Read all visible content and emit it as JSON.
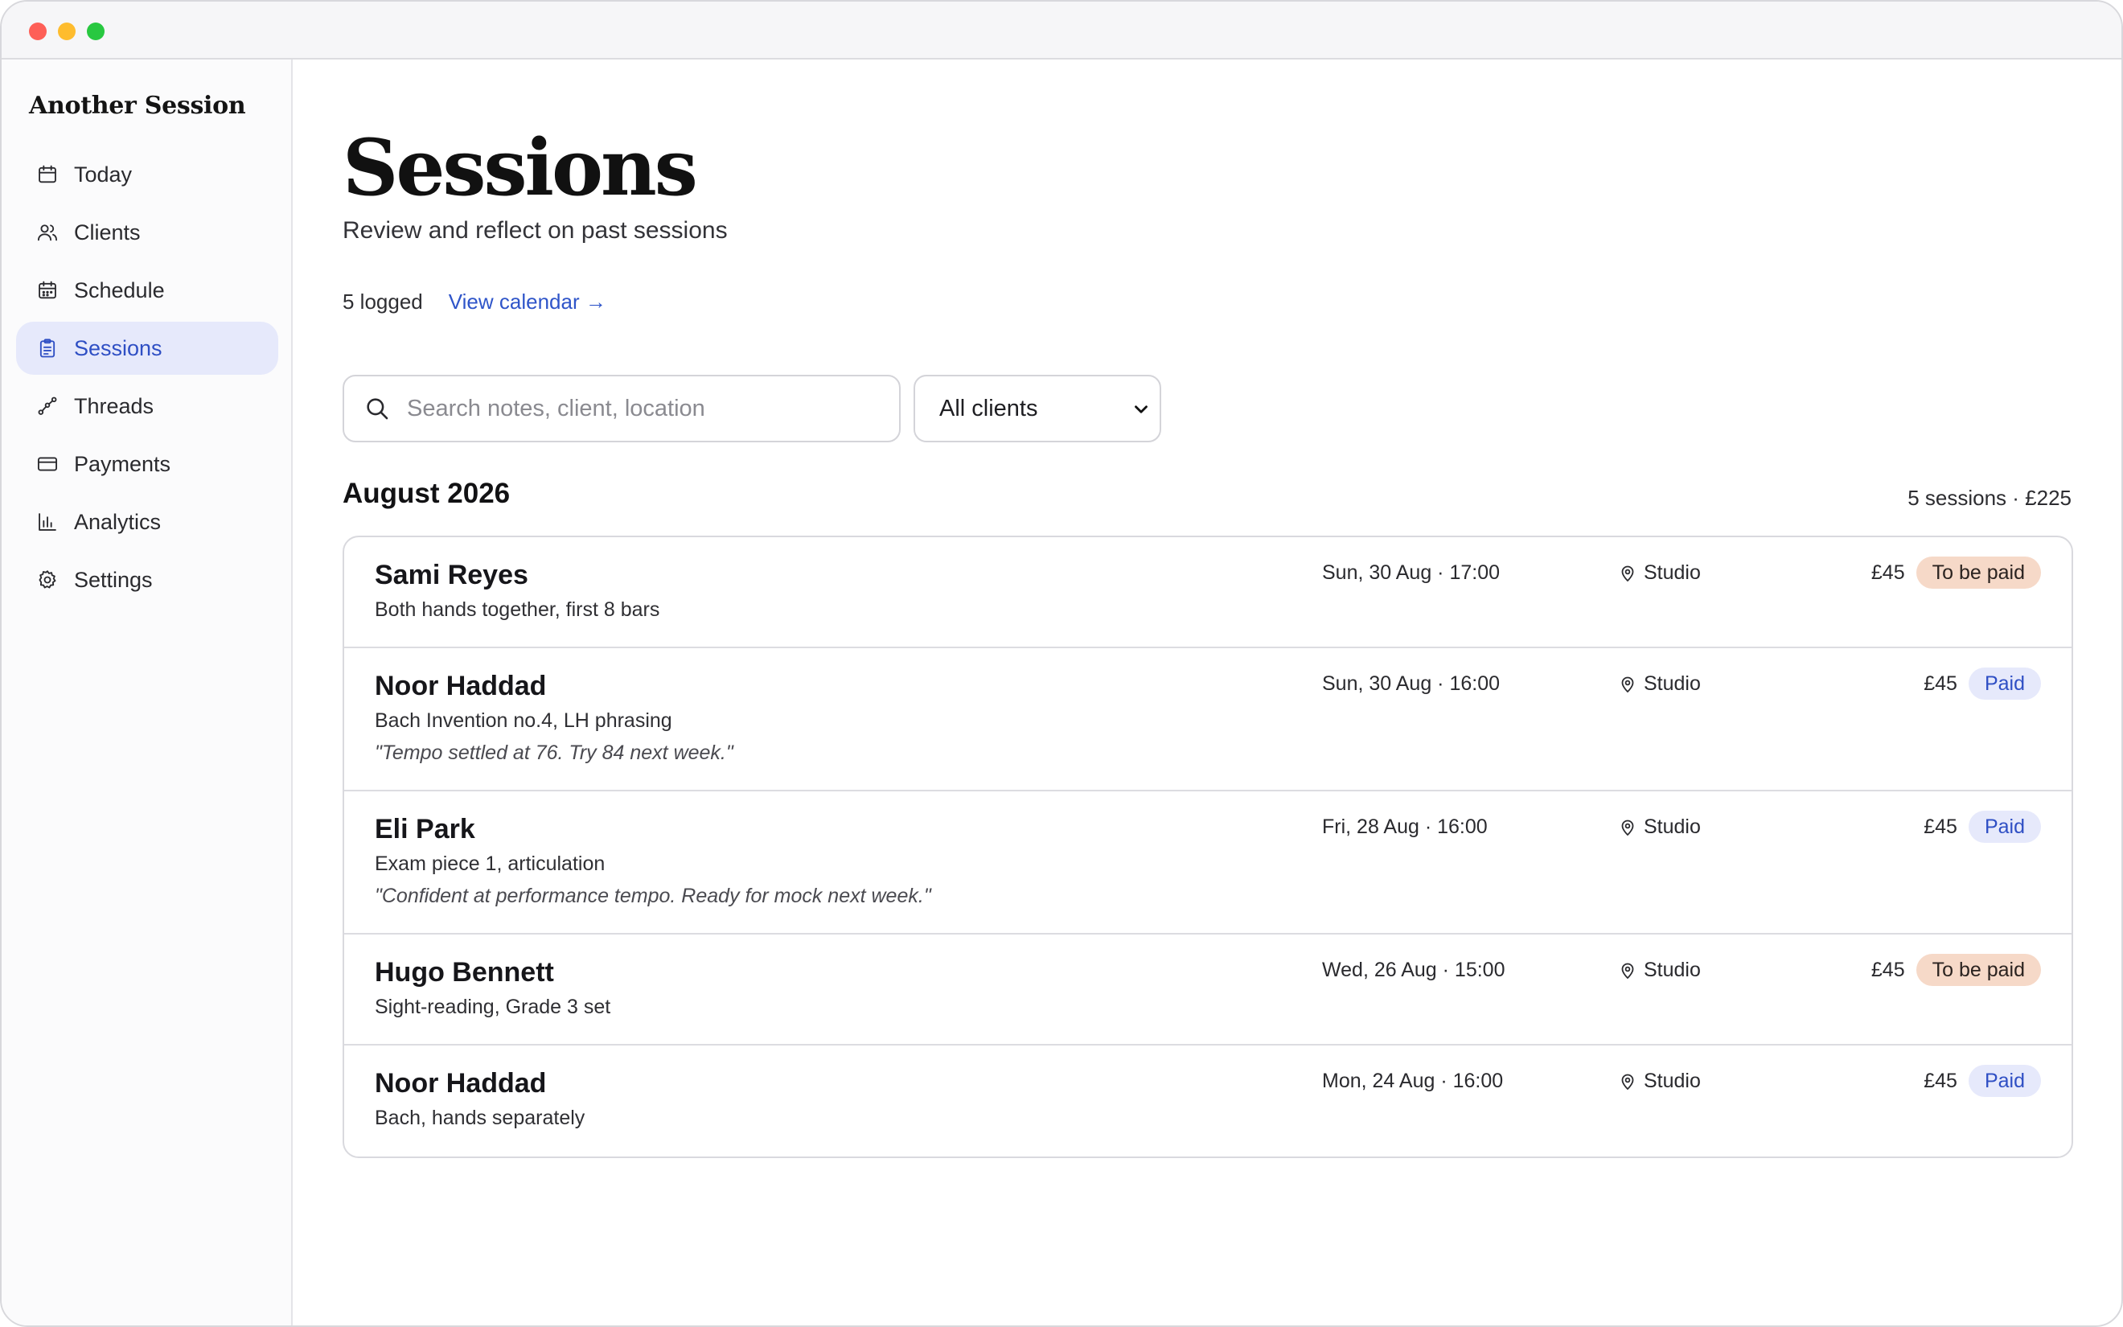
{
  "app": {
    "brand": "Another Session"
  },
  "sidebar": {
    "items": [
      {
        "label": "Today",
        "icon": "calendar-icon",
        "active": false
      },
      {
        "label": "Clients",
        "icon": "users-icon",
        "active": false
      },
      {
        "label": "Schedule",
        "icon": "calendar-grid-icon",
        "active": false
      },
      {
        "label": "Sessions",
        "icon": "clipboard-icon",
        "active": true
      },
      {
        "label": "Threads",
        "icon": "threads-icon",
        "active": false
      },
      {
        "label": "Payments",
        "icon": "credit-card-icon",
        "active": false
      },
      {
        "label": "Analytics",
        "icon": "bar-chart-icon",
        "active": false
      },
      {
        "label": "Settings",
        "icon": "gear-icon",
        "active": false
      }
    ]
  },
  "header": {
    "title": "Sessions",
    "subtitle": "Review and reflect on past sessions",
    "count": "5 logged",
    "calendar_link": "View calendar →"
  },
  "filters": {
    "search_placeholder": "Search notes, client, location",
    "search_value": "",
    "client_select": "All clients"
  },
  "group": {
    "month": "August 2026",
    "summary": "5 sessions · £225"
  },
  "sessions": [
    {
      "name": "Sami Reyes",
      "desc": "Both hands together, first 8 bars",
      "quote": "",
      "date": "Sun, 30 Aug · 17:00",
      "location": "Studio",
      "price": "£45",
      "status": "To be paid",
      "paid": false
    },
    {
      "name": "Noor Haddad",
      "desc": "Bach Invention no.4, LH phrasing",
      "quote": "\"Tempo settled at 76. Try 84 next week.\"",
      "date": "Sun, 30 Aug · 16:00",
      "location": "Studio",
      "price": "£45",
      "status": "Paid",
      "paid": true
    },
    {
      "name": "Eli Park",
      "desc": "Exam piece 1, articulation",
      "quote": "\"Confident at performance tempo. Ready for mock next week.\"",
      "date": "Fri, 28 Aug · 16:00",
      "location": "Studio",
      "price": "£45",
      "status": "Paid",
      "paid": true
    },
    {
      "name": "Hugo Bennett",
      "desc": "Sight-reading, Grade 3 set",
      "quote": "",
      "date": "Wed, 26 Aug · 15:00",
      "location": "Studio",
      "price": "£45",
      "status": "To be paid",
      "paid": false
    },
    {
      "name": "Noor Haddad",
      "desc": "Bach, hands separately",
      "quote": "",
      "date": "Mon, 24 Aug · 16:00",
      "location": "Studio",
      "price": "£45",
      "status": "Paid",
      "paid": true
    }
  ],
  "colors": {
    "accent": "#2f4fc4",
    "active_bg": "#e6e9fb",
    "unpaid_bg": "#f6d9c8",
    "link": "#2f55c9"
  }
}
